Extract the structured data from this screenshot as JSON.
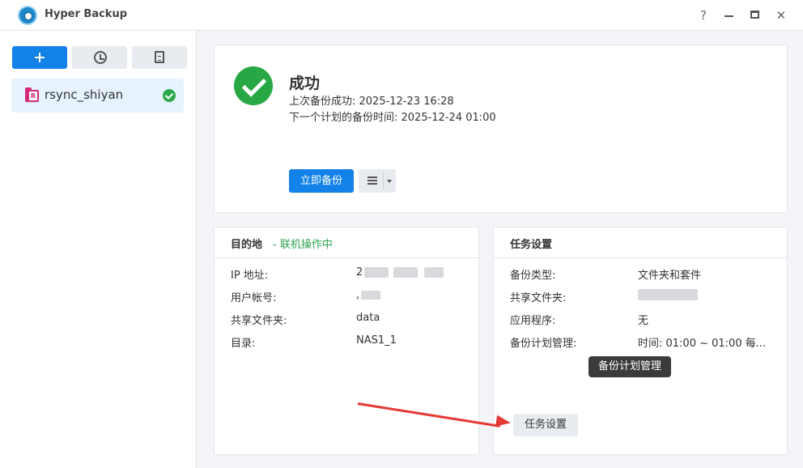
{
  "window": {
    "title": "Hyper Backup",
    "controls": {
      "help": "?"
    }
  },
  "sidebar": {
    "toolbar": [
      {
        "icon": "plus-icon"
      },
      {
        "icon": "history-icon"
      },
      {
        "icon": "document-icon"
      }
    ],
    "tasks": [
      {
        "label": "rsync_shiyan",
        "status": "success"
      }
    ]
  },
  "status": {
    "title": "成功",
    "last_backup": "上次备份成功: 2025-12-23 16:28",
    "next_backup": "下一个计划的备份时间: 2025-12-24 01:00",
    "backup_now_label": "立即备份"
  },
  "destination": {
    "title": "目的地",
    "status_text": "- 联机操作中",
    "status_color": "#2ea44f",
    "rows": [
      {
        "label": "IP 地址:",
        "value": "2"
      },
      {
        "label": "用户帐号:",
        "value": ","
      },
      {
        "label": "共享文件夹:",
        "value": "data"
      },
      {
        "label": "目录:",
        "value": "NAS1_1"
      }
    ]
  },
  "settings": {
    "title": "任务设置",
    "rows": [
      {
        "label": "备份类型:",
        "value": "文件夹和套件"
      },
      {
        "label": "共享文件夹:",
        "value": ""
      },
      {
        "label": "应用程序:",
        "value": "无"
      },
      {
        "label": "备份计划管理:",
        "value": "时间: 01:00 ~ 01:00 每..."
      }
    ],
    "tooltip": "备份计划管理",
    "button_label": "任务设置"
  },
  "colors": {
    "primary": "#1281e8",
    "success": "#28a745",
    "arrow": "#e53935"
  }
}
